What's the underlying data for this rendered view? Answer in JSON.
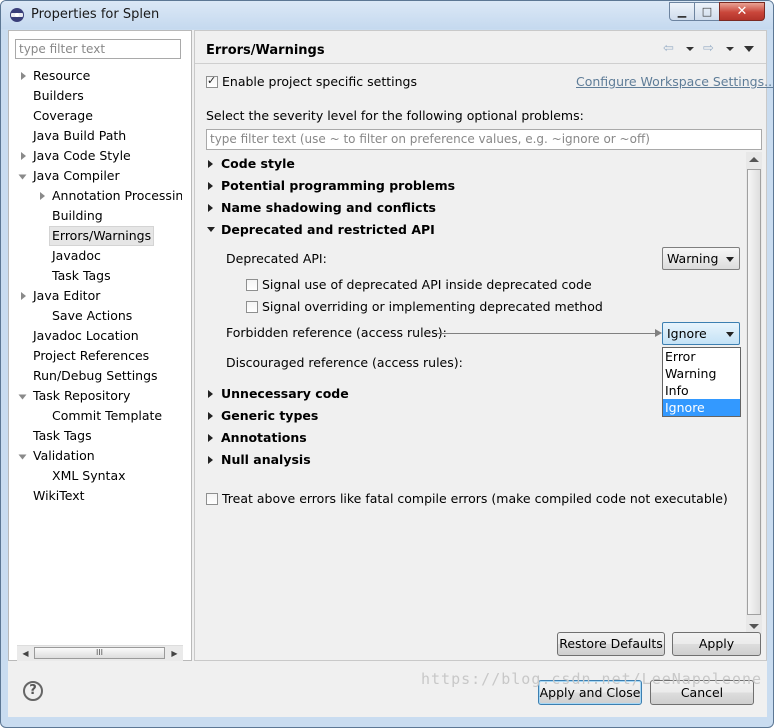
{
  "window": {
    "title": "Properties for Splen"
  },
  "left": {
    "filter_placeholder": "type filter text",
    "tree": [
      {
        "label": "Resource"
      },
      {
        "label": "Builders"
      },
      {
        "label": "Coverage"
      },
      {
        "label": "Java Build Path"
      },
      {
        "label": "Java Code Style"
      },
      {
        "label": "Java Compiler"
      },
      {
        "label": "Annotation Processin"
      },
      {
        "label": "Building"
      },
      {
        "label": "Errors/Warnings"
      },
      {
        "label": "Javadoc"
      },
      {
        "label": "Task Tags"
      },
      {
        "label": "Java Editor"
      },
      {
        "label": "Save Actions"
      },
      {
        "label": "Javadoc Location"
      },
      {
        "label": "Project References"
      },
      {
        "label": "Run/Debug Settings"
      },
      {
        "label": "Task Repository"
      },
      {
        "label": "Commit Template"
      },
      {
        "label": "Task Tags"
      },
      {
        "label": "Validation"
      },
      {
        "label": "XML Syntax"
      },
      {
        "label": "WikiText"
      }
    ],
    "scroll_grip": "III"
  },
  "right": {
    "title": "Errors/Warnings",
    "enable_project_specific": "Enable project specific settings",
    "configure_link": "Configure Workspace Settings...",
    "severity_intro": "Select the severity level for the following optional problems:",
    "severity_filter_placeholder": "type filter text (use ~ to filter on preference values, e.g. ~ignore or ~off)",
    "sections": [
      {
        "label": "Code style"
      },
      {
        "label": "Potential programming problems"
      },
      {
        "label": "Name shadowing and conflicts"
      },
      {
        "label": "Deprecated and restricted API"
      },
      {
        "label": "Unnecessary code"
      },
      {
        "label": "Generic types"
      },
      {
        "label": "Annotations"
      },
      {
        "label": "Null analysis"
      }
    ],
    "deprecated_api_label": "Deprecated API:",
    "deprecated_api_value": "Warning",
    "signal_use_label": "Signal use of deprecated API inside deprecated code",
    "signal_override_label": "Signal overriding or implementing deprecated method",
    "forbidden_label": "Forbidden reference (access rules):",
    "forbidden_value": "Ignore",
    "discouraged_label": "Discouraged reference (access rules):",
    "dropdown_options": [
      "Error",
      "Warning",
      "Info",
      "Ignore"
    ],
    "treat_fatal_label": "Treat above errors like fatal compile errors (make compiled code not executable)",
    "restore_defaults": "Restore Defaults",
    "apply": "Apply"
  },
  "footer": {
    "help": "?",
    "apply_and_close": "Apply and Close",
    "cancel": "Cancel"
  },
  "watermark": "https://blog.csdn.net/LeeNapoleone",
  "colors": {
    "selection": "#3399ff",
    "link": "#5f7d98",
    "window_frame": "#c9dcf0"
  }
}
